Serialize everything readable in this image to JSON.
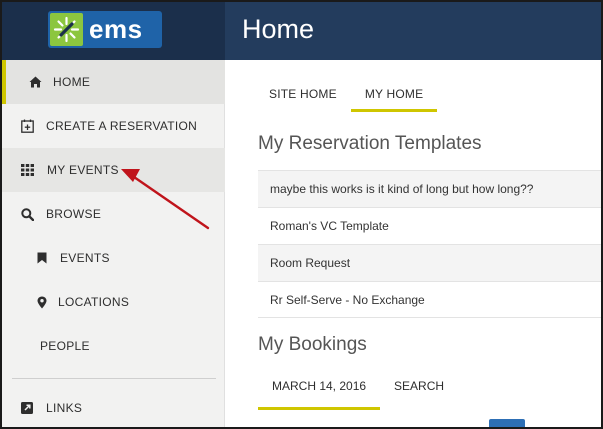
{
  "brand": {
    "name": "ems"
  },
  "header": {
    "title": "Home"
  },
  "sidebar": {
    "items": [
      {
        "label": "HOME",
        "icon": "home-icon"
      },
      {
        "label": "CREATE A RESERVATION",
        "icon": "calendar-plus-icon"
      },
      {
        "label": "MY EVENTS",
        "icon": "grid-icon"
      },
      {
        "label": "BROWSE",
        "icon": "search-icon"
      },
      {
        "label": "EVENTS",
        "icon": "bookmark-icon"
      },
      {
        "label": "LOCATIONS",
        "icon": "map-marker-icon"
      },
      {
        "label": "PEOPLE",
        "icon": ""
      },
      {
        "label": "LINKS",
        "icon": "external-link-icon"
      }
    ]
  },
  "main": {
    "tabs": [
      {
        "label": "SITE HOME"
      },
      {
        "label": "MY HOME"
      }
    ],
    "templates_title": "My Reservation Templates",
    "templates": [
      "maybe this works is it kind of long but how long??",
      "Roman's VC Template",
      "Room Request",
      "Rr Self-Serve - No Exchange"
    ],
    "bookings_title": "My Bookings",
    "booking_tabs": [
      {
        "label": "MARCH 14, 2016"
      },
      {
        "label": "SEARCH"
      }
    ]
  },
  "colors": {
    "header_bg": "#233c5d",
    "logo_green": "#8cc63f",
    "logo_blue": "#1f63a8",
    "accent_yellow": "#cfc600",
    "arrow_red": "#c0141b"
  }
}
